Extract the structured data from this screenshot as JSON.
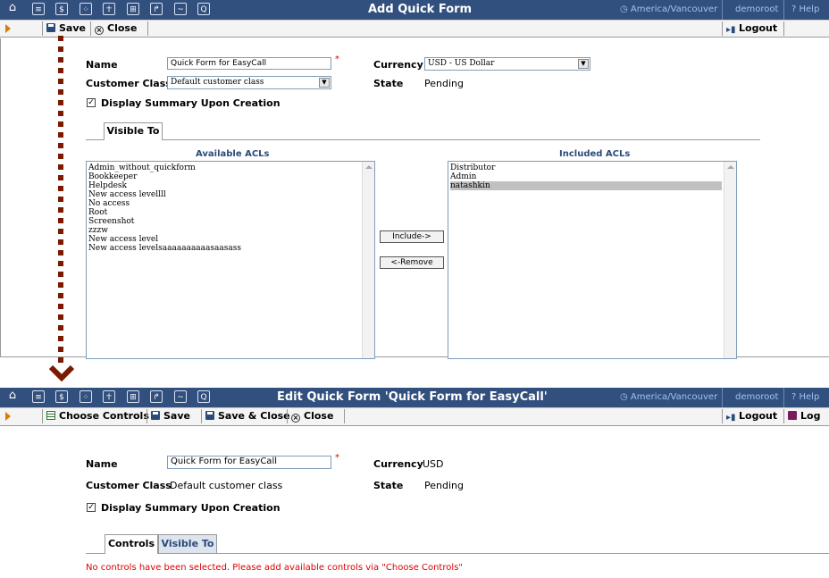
{
  "top": {
    "title": "Add Quick Form",
    "timezone": "America/Vancouver",
    "user": "demoroot",
    "help": "Help",
    "toolbar": {
      "save": "Save",
      "close": "Close",
      "logout": "Logout"
    },
    "form": {
      "name_label": "Name",
      "name_value": "Quick Form for EasyCall",
      "customer_class_label": "Customer Class",
      "customer_class_value": "Default customer class",
      "currency_label": "Currency",
      "currency_value": "USD - US Dollar",
      "state_label": "State",
      "state_value": "Pending",
      "display_summary_label": "Display Summary Upon Creation",
      "display_summary_checked": true
    },
    "tabs": [
      "Visible To"
    ],
    "acl": {
      "available_header": "Available ACLs",
      "included_header": "Included ACLs",
      "available": [
        "Admin_without_quickform",
        "Bookkeeper",
        "Helpdesk",
        "New access levellll",
        "No access",
        "Root",
        "Screenshot",
        "zzzw",
        "New access level",
        "New access levelsaaaaaaaaaasaasass"
      ],
      "included": [
        "Distributor",
        "Admin",
        "natashkin"
      ],
      "selected_included": "natashkin",
      "include_button": "Include->",
      "remove_button": "<-Remove"
    }
  },
  "bottom": {
    "title": "Edit Quick Form 'Quick Form for EasyCall'",
    "timezone": "America/Vancouver",
    "user": "demoroot",
    "help": "Help",
    "toolbar": {
      "choose_controls": "Choose Controls",
      "save": "Save",
      "save_close": "Save & Close",
      "close": "Close",
      "logout": "Logout",
      "log": "Log"
    },
    "form": {
      "name_label": "Name",
      "name_value": "Quick Form for EasyCall",
      "customer_class_label": "Customer Class",
      "customer_class_value": "Default customer class",
      "currency_label": "Currency",
      "currency_value": "USD",
      "state_label": "State",
      "state_value": "Pending",
      "display_summary_label": "Display Summary Upon Creation",
      "display_summary_checked": true
    },
    "tabs": [
      "Controls",
      "Visible To"
    ],
    "message": "No controls have been selected. Please add available controls via \"Choose Controls\""
  },
  "colors": {
    "header_bg": "#32507e",
    "accent_orange": "#e07a00",
    "error_red": "#dd0000",
    "arrow": "#7a1a00"
  }
}
